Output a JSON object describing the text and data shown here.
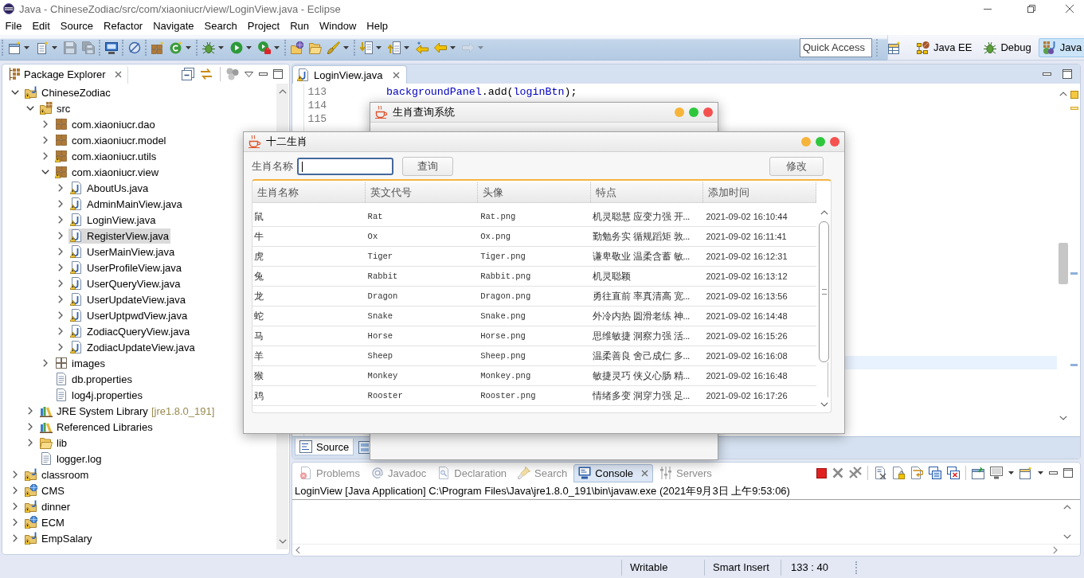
{
  "window": {
    "title": "Java - ChineseZodiac/src/com/xiaoniucr/view/LoginView.java - Eclipse"
  },
  "menu": [
    "File",
    "Edit",
    "Source",
    "Refactor",
    "Navigate",
    "Search",
    "Project",
    "Run",
    "Window",
    "Help"
  ],
  "toolbar": {
    "groups": [
      [
        {
          "disabled": false,
          "dropdown": true
        },
        {
          "disabled": false,
          "dropdown": true
        },
        {
          "disabled": true,
          "dropdown": false
        },
        {
          "disabled": true,
          "dropdown": false
        }
      ],
      [
        {
          "disabled": false,
          "dropdown": false
        }
      ],
      [
        {
          "disabled": false,
          "dropdown": false
        }
      ],
      [
        {
          "disabled": false,
          "dropdown": false
        },
        {
          "disabled": false,
          "dropdown": true
        }
      ],
      [
        {
          "disabled": false,
          "dropdown": true
        },
        {
          "disabled": false,
          "dropdown": true
        },
        {
          "disabled": false,
          "dropdown": true
        }
      ],
      [
        {
          "disabled": false,
          "dropdown": false
        },
        {
          "disabled": false,
          "dropdown": false
        },
        {
          "disabled": false,
          "dropdown": true
        }
      ],
      [
        {
          "disabled": false,
          "dropdown": true
        },
        {
          "disabled": false,
          "dropdown": true
        },
        {
          "disabled": false,
          "dropdown": false
        },
        {
          "disabled": false,
          "dropdown": true
        },
        {
          "disabled": true,
          "dropdown": true
        }
      ]
    ],
    "quick_access": {
      "placeholder": "Quick Access"
    },
    "perspectives": [
      {
        "label": "Java EE",
        "selected": false
      },
      {
        "label": "Debug",
        "selected": false
      },
      {
        "label": "Java",
        "selected": true
      }
    ]
  },
  "package_explorer": {
    "title": "Package Explorer",
    "tree": [
      {
        "label": "ChineseZodiac",
        "kind": "project",
        "warning": true,
        "expanded": true,
        "selected": false,
        "children": [
          {
            "label": "src",
            "kind": "source-folder",
            "warning": true,
            "expanded": true,
            "selected": false,
            "children": [
              {
                "label": "com.xiaoniucr.dao",
                "kind": "package",
                "warning": false,
                "expanded": false,
                "selected": false
              },
              {
                "label": "com.xiaoniucr.model",
                "kind": "package",
                "warning": false,
                "expanded": false,
                "selected": false
              },
              {
                "label": "com.xiaoniucr.utils",
                "kind": "package",
                "warning": true,
                "expanded": false,
                "selected": false
              },
              {
                "label": "com.xiaoniucr.view",
                "kind": "package",
                "warning": true,
                "expanded": true,
                "selected": false,
                "children": [
                  {
                    "label": "AboutUs.java",
                    "kind": "java-file",
                    "warning": true,
                    "expanded": false,
                    "selected": false
                  },
                  {
                    "label": "AdminMainView.java",
                    "kind": "java-file",
                    "warning": true,
                    "expanded": false,
                    "selected": false
                  },
                  {
                    "label": "LoginView.java",
                    "kind": "java-file",
                    "warning": true,
                    "expanded": false,
                    "selected": false
                  },
                  {
                    "label": "RegisterView.java",
                    "kind": "java-file",
                    "warning": true,
                    "expanded": false,
                    "selected": true
                  },
                  {
                    "label": "UserMainView.java",
                    "kind": "java-file",
                    "warning": true,
                    "expanded": false,
                    "selected": false
                  },
                  {
                    "label": "UserProfileView.java",
                    "kind": "java-file",
                    "warning": true,
                    "expanded": false,
                    "selected": false
                  },
                  {
                    "label": "UserQueryView.java",
                    "kind": "java-file",
                    "warning": true,
                    "expanded": false,
                    "selected": false
                  },
                  {
                    "label": "UserUpdateView.java",
                    "kind": "java-file",
                    "warning": true,
                    "expanded": false,
                    "selected": false
                  },
                  {
                    "label": "UserUptpwdView.java",
                    "kind": "java-file",
                    "warning": true,
                    "expanded": false,
                    "selected": false
                  },
                  {
                    "label": "ZodiacQueryView.java",
                    "kind": "java-file",
                    "warning": true,
                    "expanded": false,
                    "selected": false
                  },
                  {
                    "label": "ZodiacUpdateView.java",
                    "kind": "java-file",
                    "warning": true,
                    "expanded": false,
                    "selected": false
                  }
                ]
              },
              {
                "label": "images",
                "kind": "empty-package",
                "warning": false,
                "expanded": false,
                "selected": false
              },
              {
                "label": "db.properties",
                "kind": "file",
                "warning": false,
                "selected": false
              },
              {
                "label": "log4j.properties",
                "kind": "file",
                "warning": false,
                "selected": false
              }
            ]
          },
          {
            "label": "JRE System Library",
            "decoration": "[jre1.8.0_191]",
            "kind": "library",
            "warning": false,
            "expanded": false,
            "selected": false
          },
          {
            "label": "Referenced Libraries",
            "kind": "library",
            "warning": false,
            "expanded": false,
            "selected": false
          },
          {
            "label": "lib",
            "kind": "folder",
            "warning": false,
            "expanded": false,
            "selected": false
          },
          {
            "label": "logger.log",
            "kind": "file",
            "warning": false,
            "selected": false
          }
        ]
      },
      {
        "label": "classroom",
        "kind": "project",
        "warning": true,
        "expanded": false,
        "selected": false
      },
      {
        "label": "CMS",
        "kind": "web-project",
        "warning": true,
        "expanded": false,
        "selected": false
      },
      {
        "label": "dinner",
        "kind": "project",
        "warning": true,
        "expanded": false,
        "selected": false
      },
      {
        "label": "ECM",
        "kind": "web-project",
        "warning": true,
        "expanded": false,
        "selected": false
      },
      {
        "label": "EmpSalary",
        "kind": "project",
        "warning": true,
        "expanded": false,
        "selected": false
      }
    ]
  },
  "editor": {
    "tabs": [
      {
        "label": "LoginView.java",
        "selected": true
      }
    ],
    "lines": [
      {
        "number": "113",
        "tokens": [
          {
            "text": "backgroundPanel",
            "kind": "field"
          },
          {
            "text": ".add(",
            "kind": "plain"
          },
          {
            "text": "loginBtn",
            "kind": "field"
          },
          {
            "text": ");",
            "kind": "plain"
          }
        ]
      },
      {
        "number": "114"
      },
      {
        "number": "115"
      }
    ],
    "bottom_tabs": [
      {
        "label": "Source",
        "selected": true
      }
    ]
  },
  "console": {
    "tabs": [
      {
        "label": "Problems",
        "selected": false
      },
      {
        "label": "Javadoc",
        "selected": false
      },
      {
        "label": "Declaration",
        "selected": false
      },
      {
        "label": "Search",
        "selected": false
      },
      {
        "label": "Console",
        "selected": true
      },
      {
        "label": "Servers",
        "selected": false
      }
    ],
    "launch": "LoginView [Java Application] C:\\Program Files\\Java\\jre1.8.0_191\\bin\\javaw.exe (2021年9月3日 上午9:53:06)"
  },
  "status_bar": [
    "Writable",
    "Smart Insert",
    "133 : 40"
  ],
  "windows": [
    {
      "title": "生肖查询系统"
    },
    {
      "title": "十二生肖",
      "search": {
        "label": "生肖名称",
        "focused": true
      },
      "query_button": "查询",
      "modify_button": "修改",
      "table": {
        "columns": [
          "生肖名称",
          "英文代号",
          "头像",
          "特点",
          "添加时间"
        ],
        "rows": [
          [
            "鼠",
            "Rat",
            "Rat.png",
            "机灵聪慧 应变力强 开...",
            "2021-09-02 16:10:44"
          ],
          [
            "牛",
            "Ox",
            "Ox.png",
            "勤勉务实 循规蹈矩 敦...",
            "2021-09-02 16:11:41"
          ],
          [
            "虎",
            "Tiger",
            "Tiger.png",
            "谦卑敬业 温柔含蓄 敏...",
            "2021-09-02 16:12:31"
          ],
          [
            "兔",
            "Rabbit",
            "Rabbit.png",
            "机灵聪颖",
            "2021-09-02 16:13:12"
          ],
          [
            "龙",
            "Dragon",
            "Dragon.png",
            "勇往直前 率真清高 宽...",
            "2021-09-02 16:13:56"
          ],
          [
            "蛇",
            "Snake",
            "Snake.png",
            "外冷内热 圆滑老练 神...",
            "2021-09-02 16:14:48"
          ],
          [
            "马",
            "Horse",
            "Horse.png",
            "思维敏捷 洞察力强 活...",
            "2021-09-02 16:15:26"
          ],
          [
            "羊",
            "Sheep",
            "Sheep.png",
            "温柔善良 舍己成仁 多...",
            "2021-09-02 16:16:08"
          ],
          [
            "猴",
            "Monkey",
            "Monkey.png",
            "敏捷灵巧 侠义心肠 精...",
            "2021-09-02 16:16:48"
          ],
          [
            "鸡",
            "Rooster",
            "Rooster.png",
            "情绪多变 洞穿力强 足...",
            "2021-09-02 16:17:26"
          ]
        ]
      }
    }
  ]
}
